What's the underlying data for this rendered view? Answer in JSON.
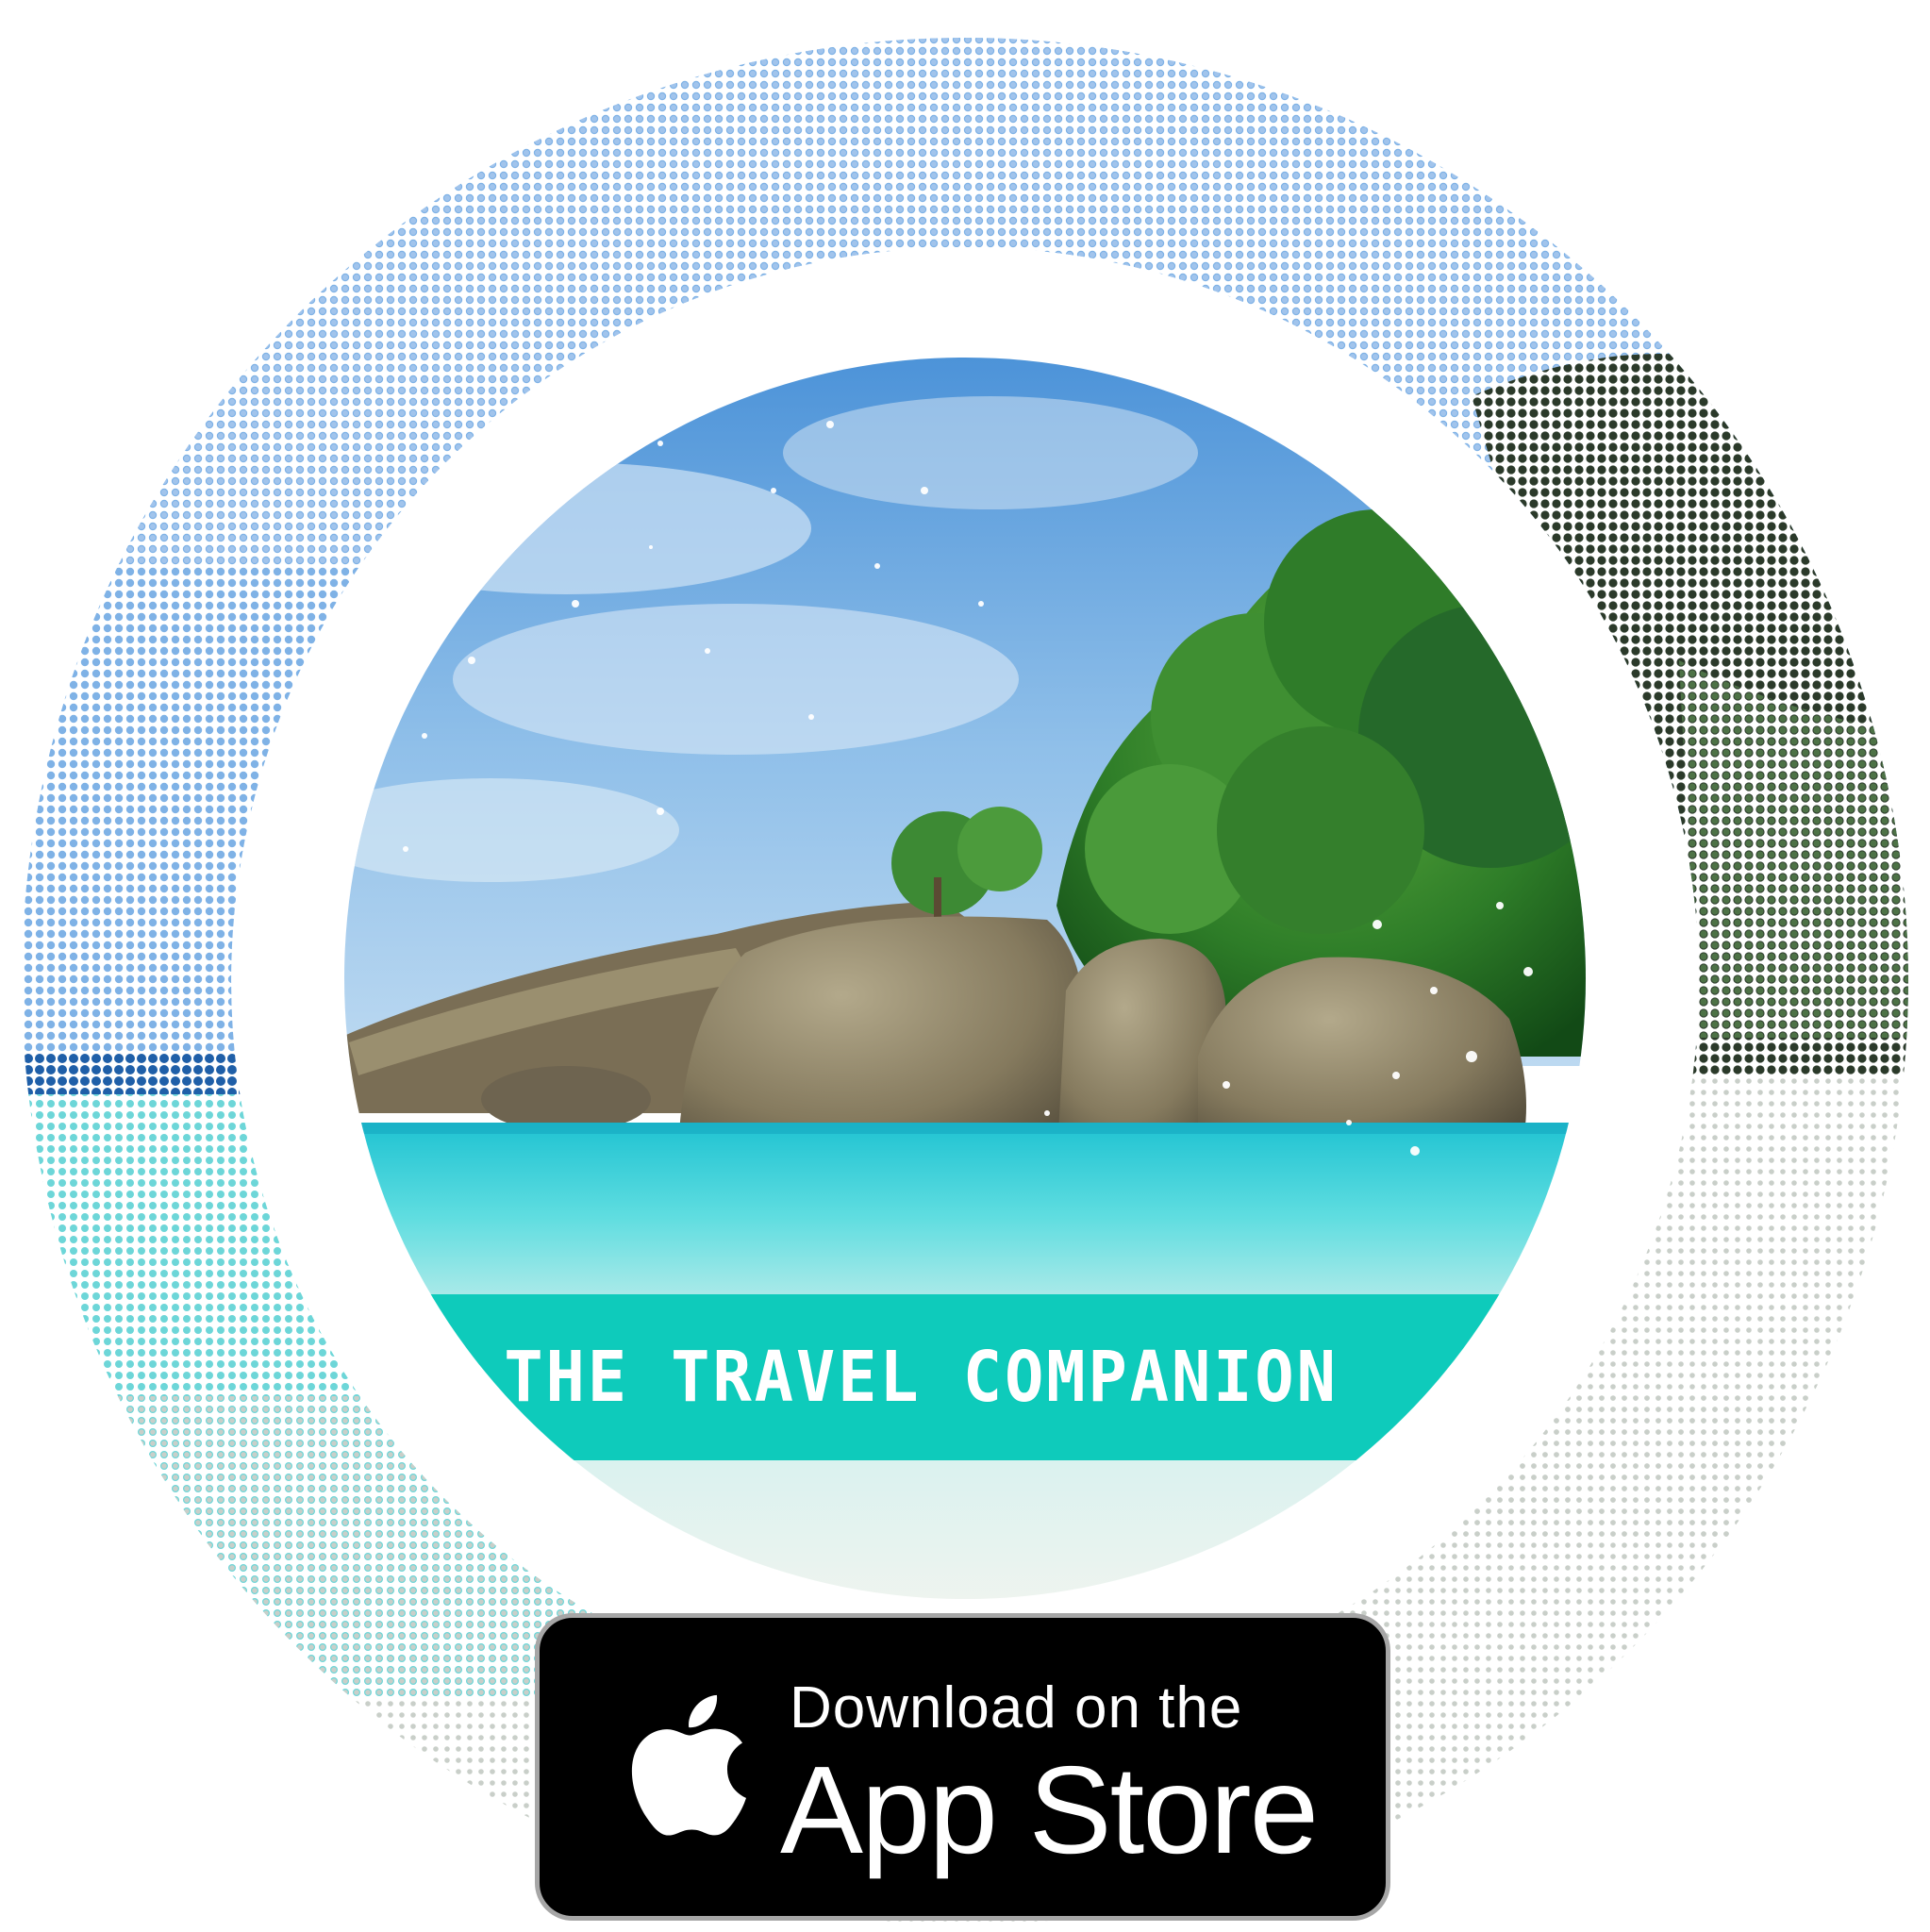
{
  "logo": {
    "title": "THE TRAVEL COMPANION",
    "banner_color": "#0ecbbb",
    "ring_colors": [
      "#6aa8e8",
      "#4fd2d6",
      "#2a2a2a"
    ]
  },
  "scene": {
    "sky_color": "#5aa0dc",
    "water_color": "#46d8da",
    "sand_color": "#eef1ef",
    "rock_color": "#8e8268",
    "foliage_color": "#2c7a2a"
  },
  "badge": {
    "line1": "Download on the",
    "line2": "App Store",
    "icon": "apple-icon",
    "background": "#000000",
    "border": "#a6a6a6"
  }
}
